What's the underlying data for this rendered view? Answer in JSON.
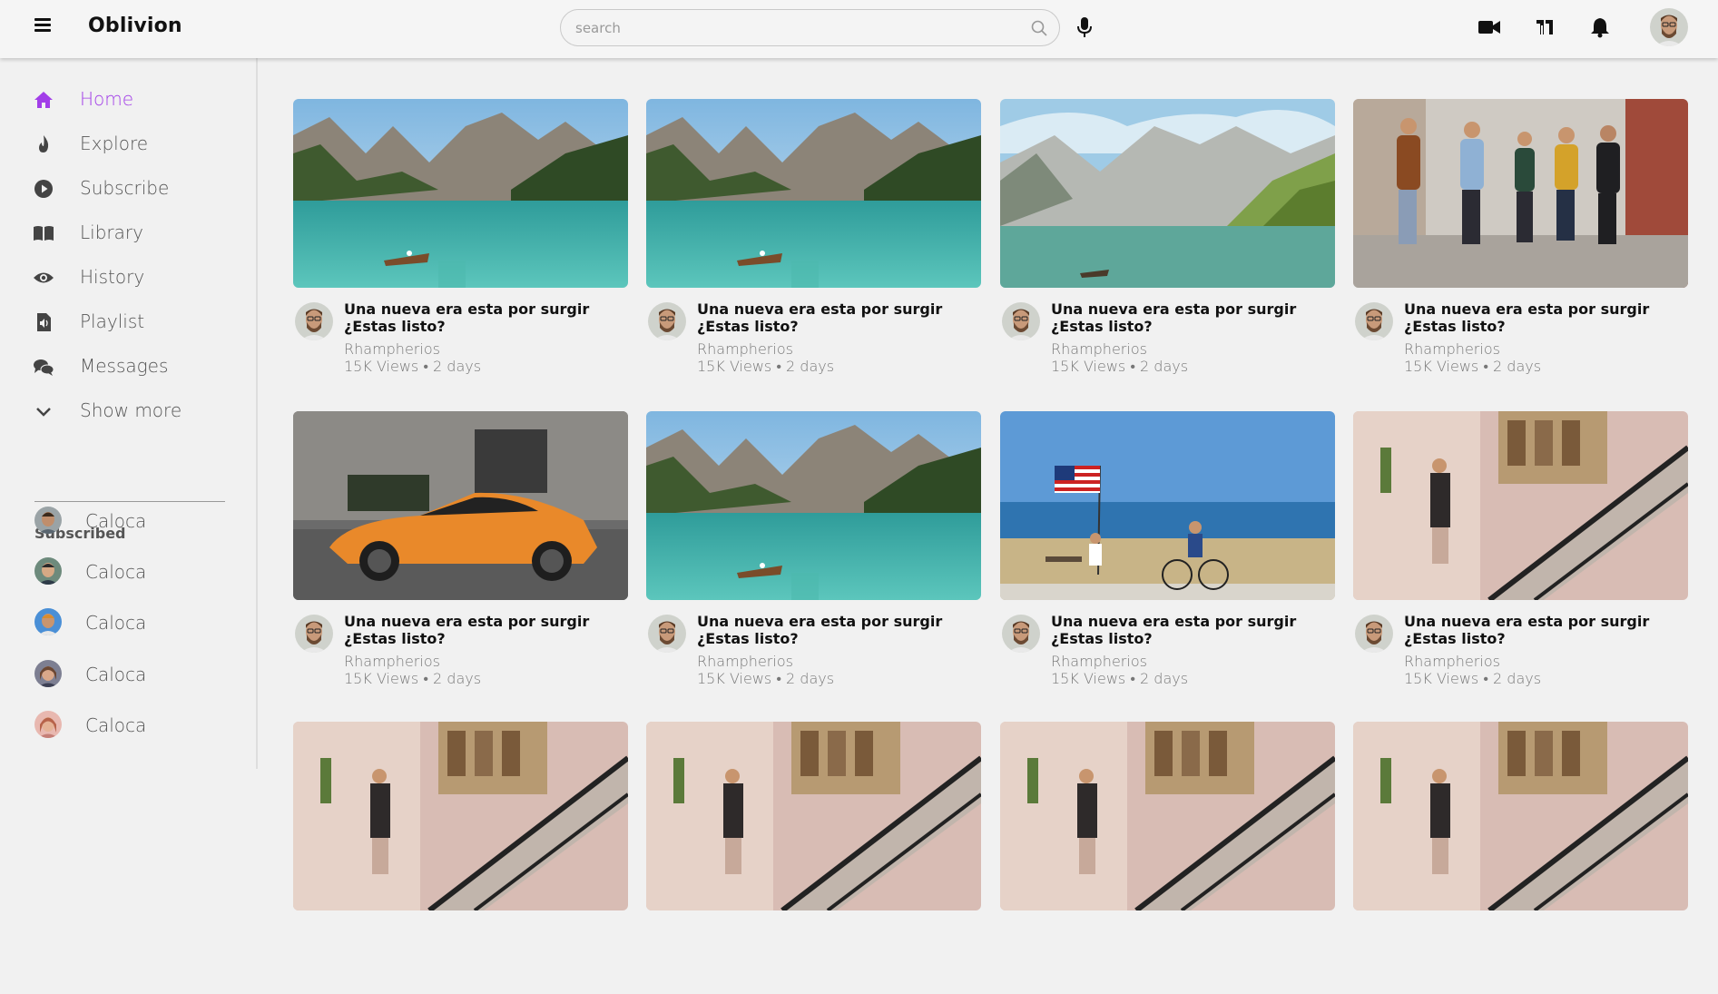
{
  "header": {
    "brand": "Oblivion",
    "search_placeholder": "search",
    "icons": [
      "menu-icon",
      "search-icon",
      "mic-icon",
      "video-camera-icon",
      "apps-icon",
      "bell-icon",
      "avatar"
    ]
  },
  "sidebar": {
    "items": [
      {
        "label": "Home",
        "icon": "home-icon",
        "active": true
      },
      {
        "label": "Explore",
        "icon": "fire-icon"
      },
      {
        "label": "Subscribe",
        "icon": "play-circle-icon"
      },
      {
        "label": "Library",
        "icon": "book-icon"
      },
      {
        "label": "History",
        "icon": "eye-icon"
      },
      {
        "label": "Playlist",
        "icon": "audio-file-icon"
      },
      {
        "label": "Messages",
        "icon": "comments-icon"
      },
      {
        "label": "Show more",
        "icon": "chevron-down-icon"
      }
    ],
    "subscribed_title": "Subscribed",
    "subscribed": [
      {
        "label": "Caloca"
      },
      {
        "label": "Caloca"
      },
      {
        "label": "Caloca"
      },
      {
        "label": "Caloca"
      },
      {
        "label": "Caloca"
      }
    ]
  },
  "colors": {
    "accent": "#a23ee8"
  },
  "videos": [
    {
      "title": "Una nueva era esta por surgir ¿Estas listo?",
      "channel": "Rhampherios",
      "meta": "15K Views • 2 days",
      "thumb": "lake-boat"
    },
    {
      "title": "Una nueva era esta por surgir ¿Estas listo?",
      "channel": "Rhampherios",
      "meta": "15K Views • 2 days",
      "thumb": "lake-boat"
    },
    {
      "title": "Una nueva era esta por surgir ¿Estas listo?",
      "channel": "Rhampherios",
      "meta": "15K Views • 2 days",
      "thumb": "mountain-lake"
    },
    {
      "title": "Una nueva era esta por surgir ¿Estas listo?",
      "channel": "Rhampherios",
      "meta": "15K Views • 2 days",
      "thumb": "friends-street"
    },
    {
      "title": "Una nueva era esta por surgir ¿Estas listo?",
      "channel": "Rhampherios",
      "meta": "15K Views • 2 days",
      "thumb": "orange-car"
    },
    {
      "title": "Una nueva era esta por surgir ¿Estas listo?",
      "channel": "Rhampherios",
      "meta": "15K Views • 2 days",
      "thumb": "lake-boat"
    },
    {
      "title": "Una nueva era esta por surgir ¿Estas listo?",
      "channel": "Rhampherios",
      "meta": "15K Views • 2 days",
      "thumb": "beach-flag"
    },
    {
      "title": "Una nueva era esta por surgir ¿Estas listo?",
      "channel": "Rhampherios",
      "meta": "15K Views • 2 days",
      "thumb": "escalator"
    },
    {
      "title": "",
      "channel": "",
      "meta": "",
      "thumb": "escalator"
    },
    {
      "title": "",
      "channel": "",
      "meta": "",
      "thumb": "escalator"
    },
    {
      "title": "",
      "channel": "",
      "meta": "",
      "thumb": "escalator"
    },
    {
      "title": "",
      "channel": "",
      "meta": "",
      "thumb": "escalator"
    }
  ]
}
